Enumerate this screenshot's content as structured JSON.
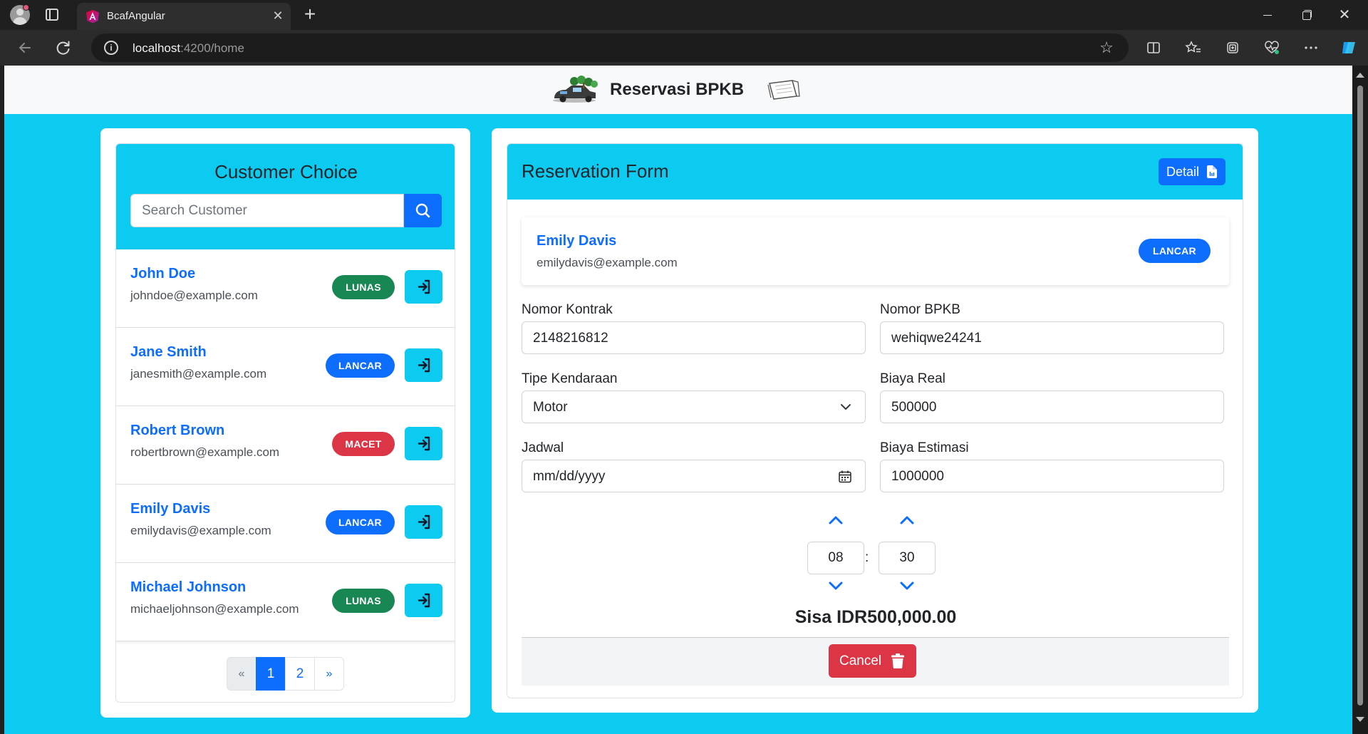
{
  "browser": {
    "tab_title": "BcafAngular",
    "tab_close": "✕",
    "new_tab": "+",
    "url_host": "localhost",
    "url_path": ":4200/home",
    "window_controls": {
      "close": "✕"
    }
  },
  "navbar": {
    "brand_title": "Reservasi BPKB"
  },
  "customer_panel": {
    "title": "Customer Choice",
    "search_placeholder": "Search Customer",
    "customers": [
      {
        "name": "John Doe",
        "email": "johndoe@example.com",
        "status": "LUNAS"
      },
      {
        "name": "Jane Smith",
        "email": "janesmith@example.com",
        "status": "LANCAR"
      },
      {
        "name": "Robert Brown",
        "email": "robertbrown@example.com",
        "status": "MACET"
      },
      {
        "name": "Emily Davis",
        "email": "emilydavis@example.com",
        "status": "LANCAR"
      },
      {
        "name": "Michael Johnson",
        "email": "michaeljohnson@example.com",
        "status": "LUNAS"
      }
    ],
    "pagination": {
      "prev": "«",
      "pages": [
        "1",
        "2"
      ],
      "next": "»",
      "current": "1"
    }
  },
  "reservation_form": {
    "title": "Reservation Form",
    "detail_button": "Detail",
    "selected_customer": {
      "name": "Emily Davis",
      "email": "emilydavis@example.com",
      "status": "LANCAR"
    },
    "fields": {
      "nomor_kontrak": {
        "label": "Nomor Kontrak",
        "value": "2148216812"
      },
      "nomor_bpkb": {
        "label": "Nomor BPKB",
        "value": "wehiqwe24241"
      },
      "tipe_kendaraan": {
        "label": "Tipe Kendaraan",
        "value": "Motor"
      },
      "biaya_real": {
        "label": "Biaya Real",
        "value": "500000"
      },
      "jadwal": {
        "label": "Jadwal",
        "placeholder": "mm/dd/yyyy"
      },
      "biaya_estimasi": {
        "label": "Biaya Estimasi",
        "value": "1000000"
      }
    },
    "time": {
      "hour": "08",
      "minute": "30",
      "separator": ":"
    },
    "sisa": "Sisa IDR500,000.00",
    "cancel_button": "Cancel"
  },
  "colors": {
    "primary": "#0d6efd",
    "info": "#0dcaf0",
    "success": "#198754",
    "danger": "#dc3545"
  },
  "icons": {
    "search": "search-icon",
    "login": "sign-in-icon",
    "detail": "file-icon",
    "calendar": "calendar-icon",
    "trash": "trash-icon",
    "chevron_up": "chevron-up-icon",
    "chevron_down": "chevron-down-icon"
  }
}
